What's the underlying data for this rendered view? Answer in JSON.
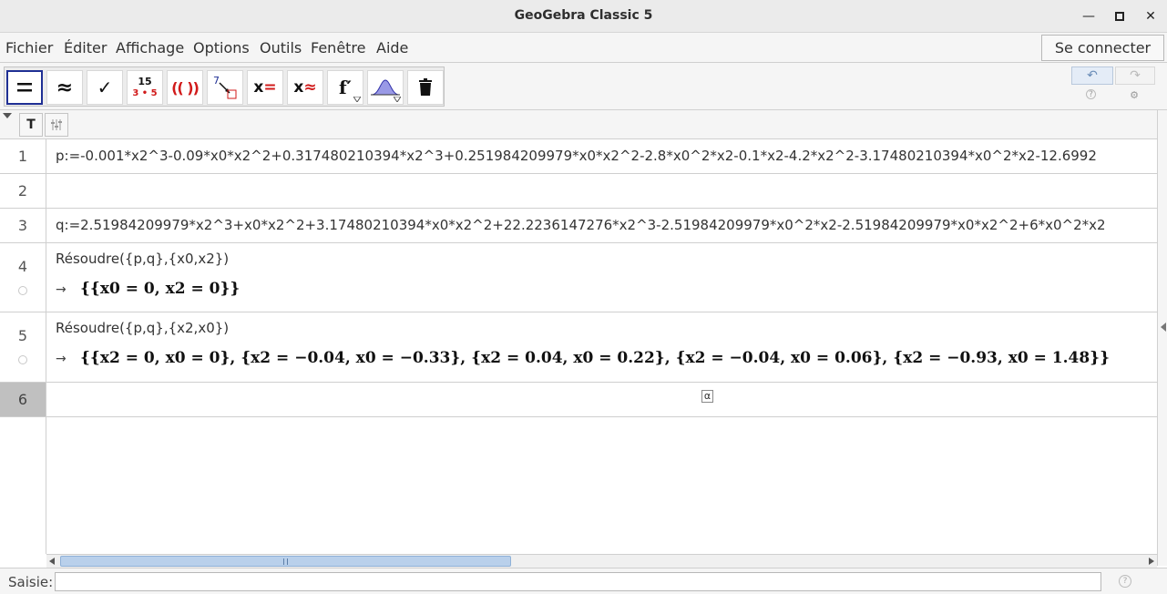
{
  "window": {
    "title": "GeoGebra Classic 5",
    "minimize": "—",
    "maximize": "□",
    "close": "✕"
  },
  "menu": {
    "items": [
      "Fichier",
      "Éditer",
      "Affichage",
      "Options",
      "Outils",
      "Fenêtre",
      "Aide"
    ],
    "login_label": "Se connecter"
  },
  "toolbar": {
    "tools": [
      {
        "name": "evaluate-tool",
        "glyph": "="
      },
      {
        "name": "numeric-tool",
        "glyph": "≈"
      },
      {
        "name": "keep-input-tool",
        "glyph": "✓"
      },
      {
        "name": "factor-tool",
        "top": "15",
        "bottom": "3 • 5"
      },
      {
        "name": "expand-tool",
        "glyph": "(( ))"
      },
      {
        "name": "substitute-tool",
        "glyph": "7"
      },
      {
        "name": "solve-tool",
        "glyph": "x="
      },
      {
        "name": "solve-numerically-tool",
        "glyph": "x≈"
      },
      {
        "name": "derivative-tool",
        "glyph": "f′"
      },
      {
        "name": "probability-tool",
        "glyph": ""
      },
      {
        "name": "delete-tool",
        "glyph": ""
      }
    ],
    "undo_icon": "↶",
    "redo_icon": "↷",
    "help_icon": "?",
    "settings_icon": "⚙"
  },
  "stylebar": {
    "text_button": "T"
  },
  "cas": {
    "rows": [
      {
        "num": "1",
        "input": "p:=-0.001*x2^3-0.09*x0*x2^2+0.317480210394*x2^3+0.251984209979*x0*x2^2-2.8*x0^2*x2-0.1*x2-4.2*x2^2-3.17480210394*x0^2*x2-12.6992"
      },
      {
        "num": "2",
        "input": ""
      },
      {
        "num": "3",
        "input": "q:=2.51984209979*x2^3+x0*x2^2+3.17480210394*x0*x2^2+22.2236147276*x2^3-2.51984209979*x0^2*x2-2.51984209979*x0*x2^2+6*x0^2*x2"
      },
      {
        "num": "4",
        "input": "Résoudre({p,q},{x0,x2})",
        "arrow": "→",
        "output": "{{x0 = 0, x2 = 0}}"
      },
      {
        "num": "5",
        "input": "Résoudre({p,q},{x2,x0})",
        "arrow": "→",
        "output": "{{x2 = 0, x0 = 0}, {x2 = −0.04, x0 = −0.33}, {x2 = 0.04, x0 = 0.22}, {x2 = −0.04, x0 = 0.06}, {x2 = −0.93, x0 = 1.48}}"
      },
      {
        "num": "6",
        "input": "",
        "alpha": "α"
      }
    ]
  },
  "inputbar": {
    "label": "Saisie:",
    "value": "",
    "help": "?"
  },
  "colors": {
    "selected_tool_border": "#1f2f94",
    "red_accent": "#d11a1a",
    "active_row": "#c0c0c0",
    "scroll_thumb": "#b9d0eb"
  }
}
